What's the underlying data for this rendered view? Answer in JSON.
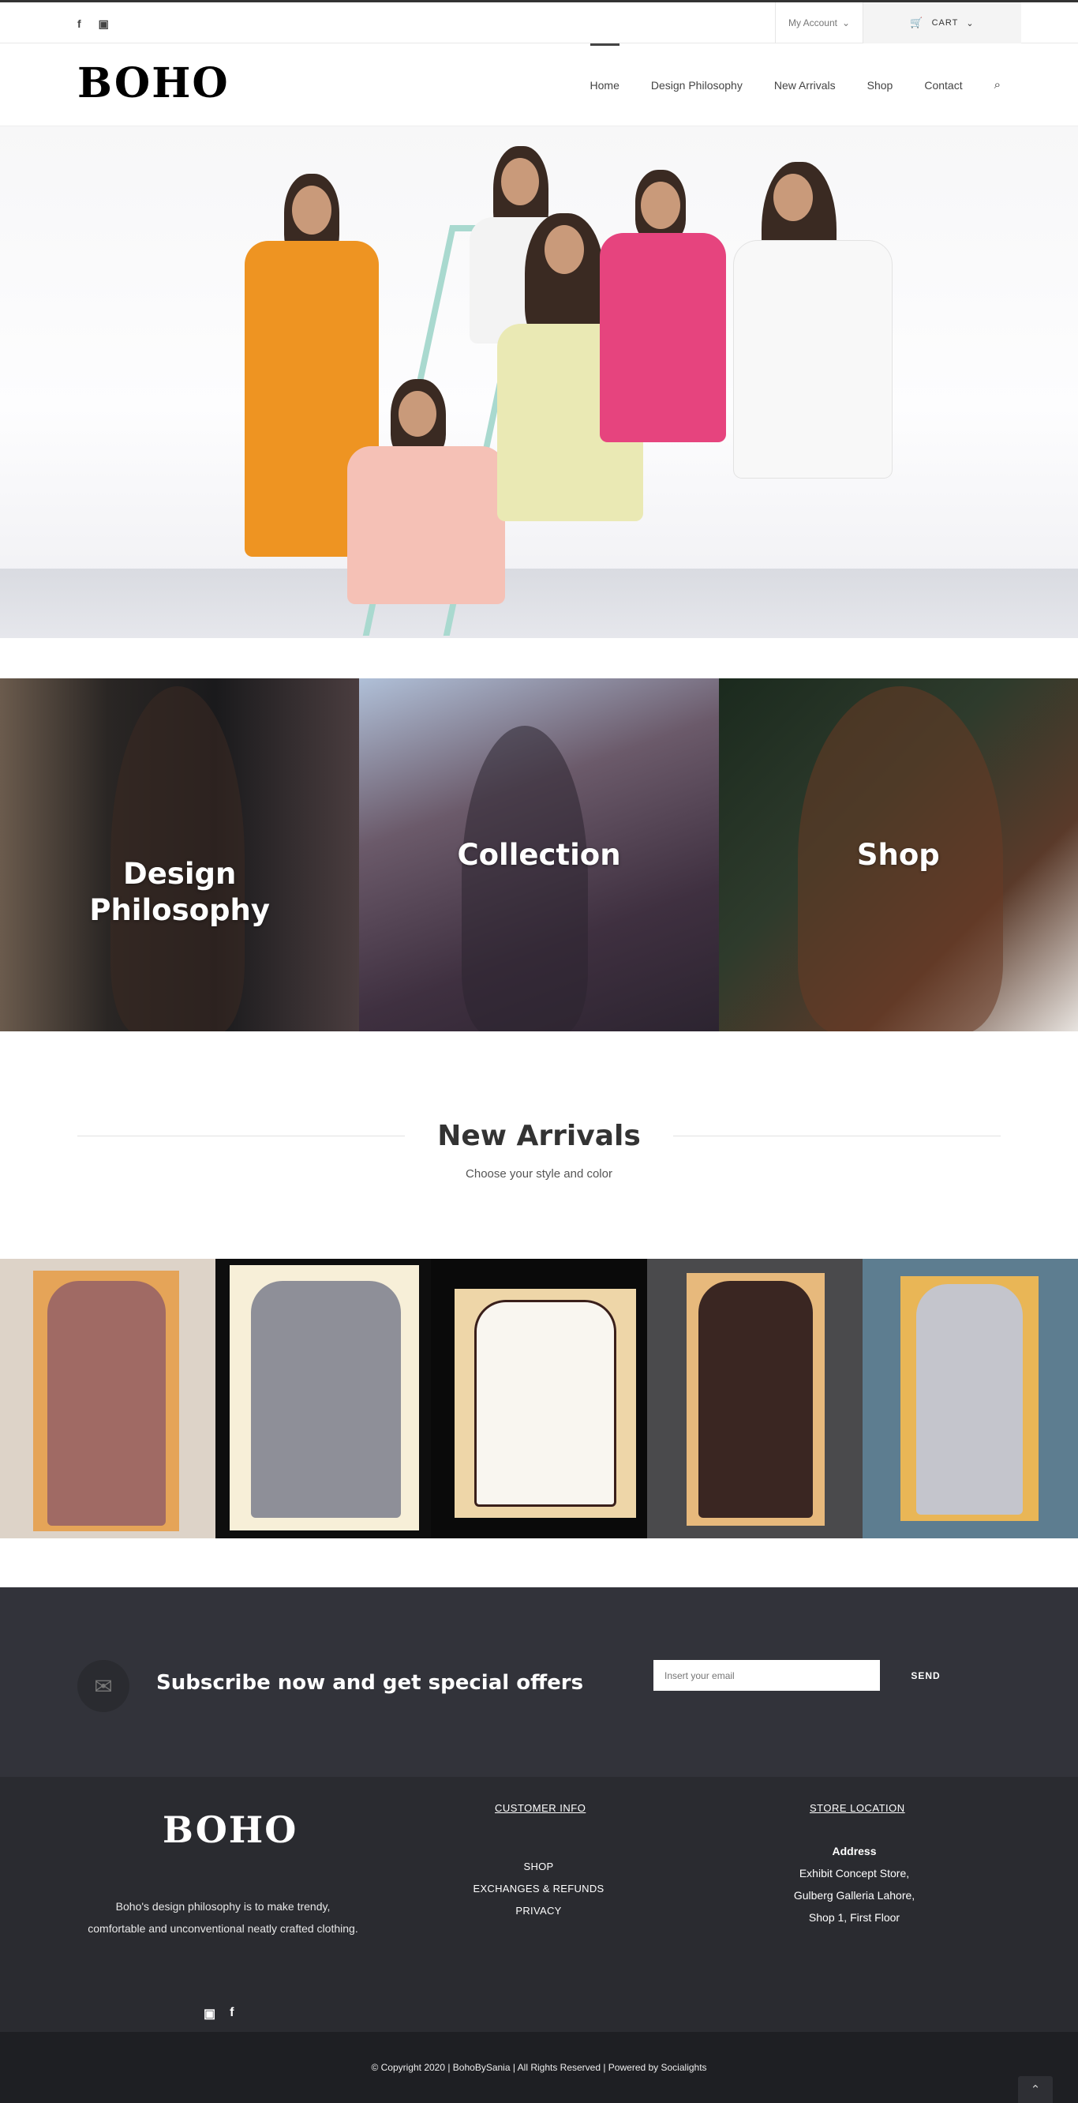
{
  "topbar": {
    "social": [
      "f",
      "▣"
    ],
    "account_label": "My Account",
    "cart_label": "CART"
  },
  "header": {
    "logo": "BOHO",
    "nav": [
      "Home",
      "Design Philosophy",
      "New Arrivals",
      "Shop",
      "Contact"
    ],
    "active_nav": "Home"
  },
  "tiles": {
    "design": "Design Philosophy",
    "collection": "Collection",
    "shop": "Shop"
  },
  "new_arrivals": {
    "title": "New Arrivals",
    "subtitle": "Choose your style and color"
  },
  "subscribe": {
    "title": "Subscribe now and get special offers",
    "placeholder": "Insert your email",
    "send_label": "SEND"
  },
  "footer": {
    "logo": "BOHO",
    "about": "Boho's design philosophy is to make trendy, comfortable and unconventional neatly crafted clothing.",
    "customer_info_title": "CUSTOMER INFO",
    "links": [
      "SHOP",
      "EXCHANGES & REFUNDS",
      "PRIVACY"
    ],
    "store_title": "STORE LOCATION",
    "address_title": "Address",
    "address_lines": [
      "Exhibit Concept Store,",
      "Gulberg Galleria Lahore,",
      "Shop 1, First Floor"
    ],
    "social": [
      "▣",
      "f"
    ],
    "copyright": "© Copyright 2020  |  BohoBySania  |  All Rights Reserved  |  Powered by Socialights"
  },
  "colors": {
    "subscribe_bg": "#32333a",
    "footer_bg": "#2a2b30",
    "bottombar_bg": "#1e1f23"
  }
}
